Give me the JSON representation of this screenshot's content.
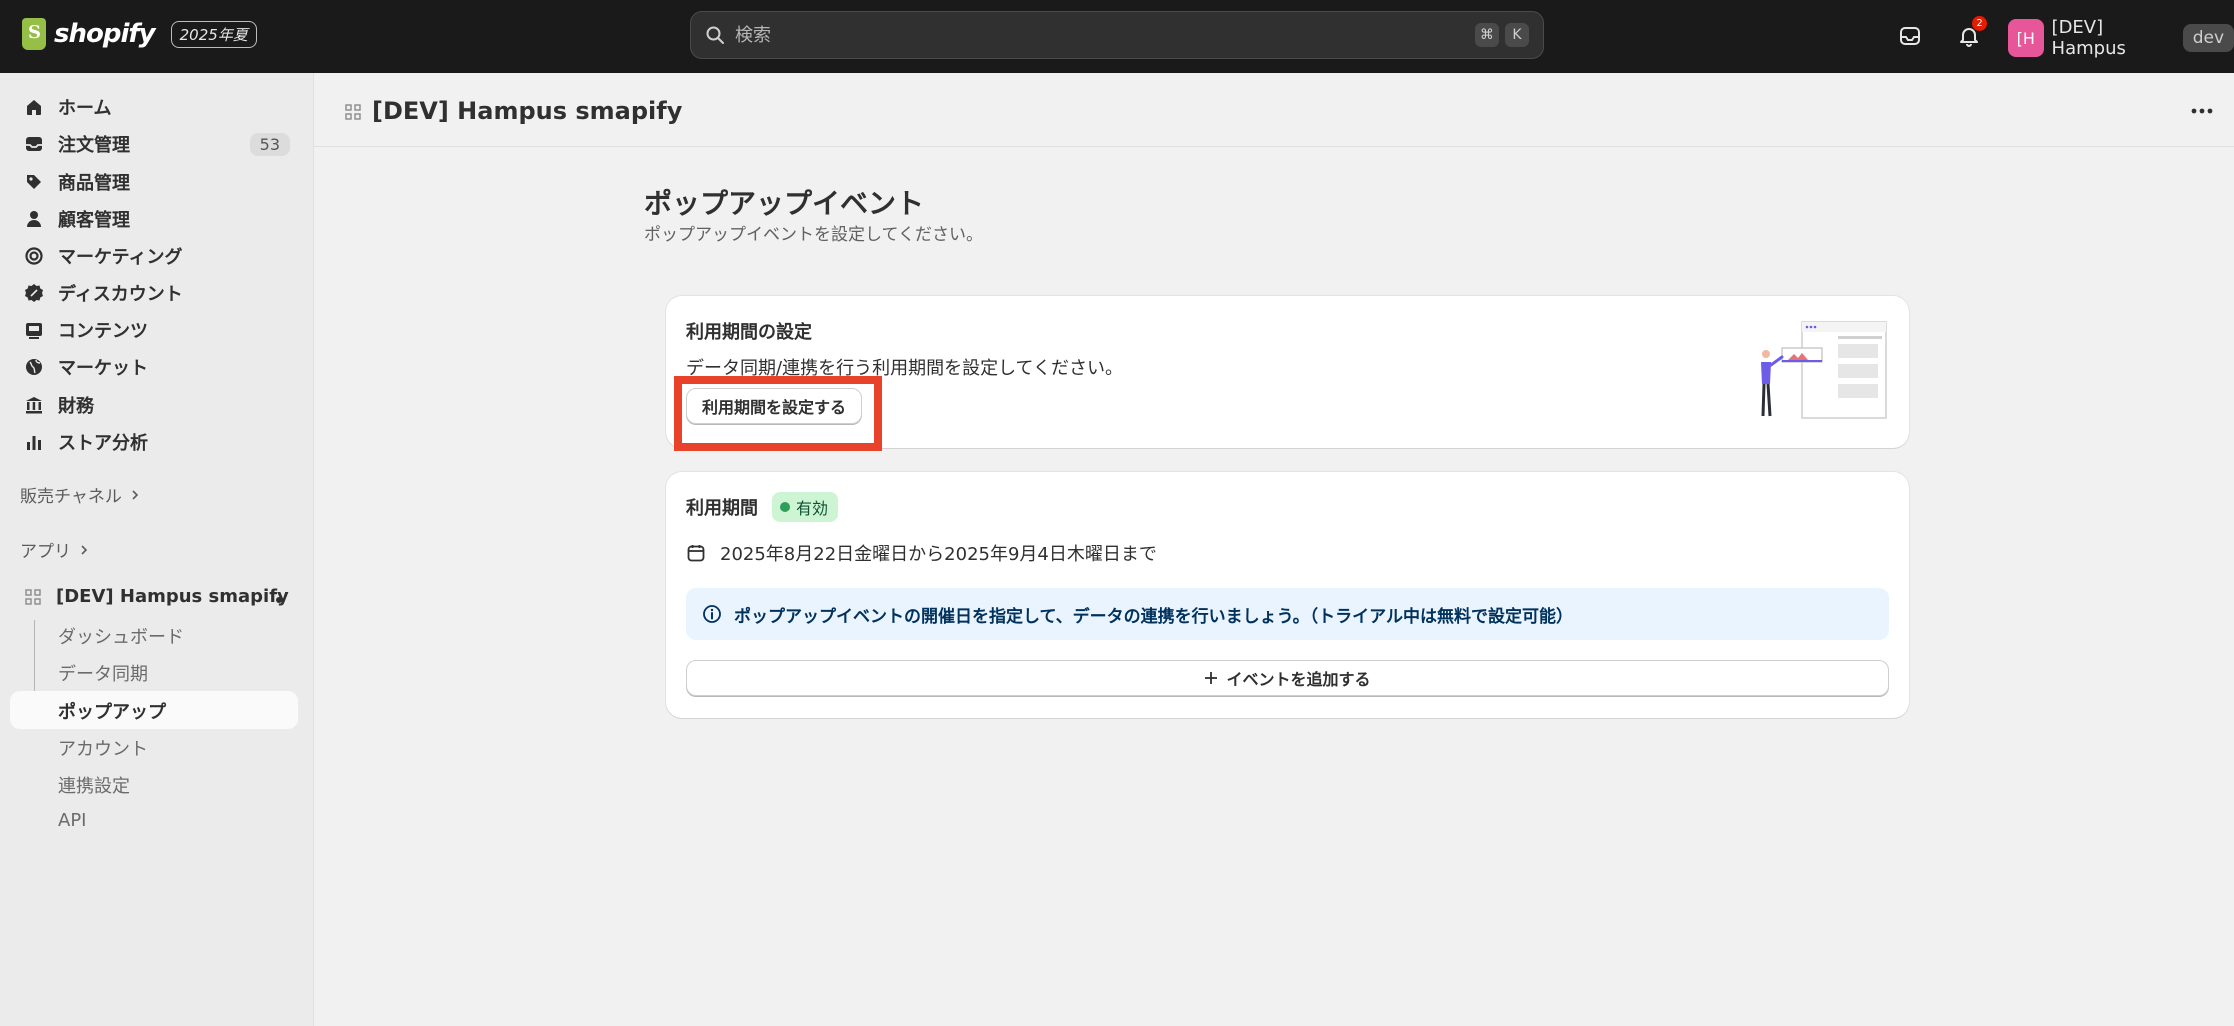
{
  "topbar": {
    "logo_text": "shopify",
    "season_badge": "2025年夏",
    "search_placeholder": "検索",
    "search_shortcut": [
      "⌘",
      "K"
    ],
    "notification_count": "2",
    "user_initials": "[H",
    "user_name": "[DEV] Hampus",
    "env_badge": "dev"
  },
  "sidebar": {
    "items": [
      {
        "label": "ホーム",
        "icon": "home-icon"
      },
      {
        "label": "注文管理",
        "icon": "inbox-icon",
        "count": "53"
      },
      {
        "label": "商品管理",
        "icon": "tag-icon"
      },
      {
        "label": "顧客管理",
        "icon": "person-icon"
      },
      {
        "label": "マーケティング",
        "icon": "target-icon"
      },
      {
        "label": "ディスカウント",
        "icon": "discount-icon"
      },
      {
        "label": "コンテンツ",
        "icon": "image-icon"
      },
      {
        "label": "マーケット",
        "icon": "globe-icon"
      },
      {
        "label": "財務",
        "icon": "bank-icon"
      },
      {
        "label": "ストア分析",
        "icon": "chart-icon"
      }
    ],
    "sales_channels_label": "販売チャネル",
    "apps_label": "アプリ",
    "app_name": "[DEV] Hampus smapify",
    "app_sub_items": [
      "ダッシュボード",
      "データ同期",
      "ポップアップ",
      "アカウント",
      "連携設定",
      "API"
    ]
  },
  "header": {
    "title": "[DEV] Hampus smapify"
  },
  "page": {
    "title": "ポップアップイベント",
    "subtitle": "ポップアップイベントを設定してください。"
  },
  "period_card": {
    "title": "利用期間の設定",
    "description": "データ同期/連携を行う利用期間を設定してください。",
    "button_label": "利用期間を設定する"
  },
  "status_card": {
    "title": "利用期間",
    "badge": "有効",
    "date_range": "2025年8月22日金曜日から2025年9月4日木曜日まで",
    "banner_text": "ポップアップイベントの開催日を指定して、データの連携を行いましょう。（トライアル中は無料で設定可能）",
    "add_button_label": "イベントを追加する"
  },
  "colors": {
    "topbar_bg": "#1a1a1a",
    "highlight": "#e8432a",
    "success_bg": "#cdf4d3",
    "info_bg": "#eaf4ff"
  }
}
